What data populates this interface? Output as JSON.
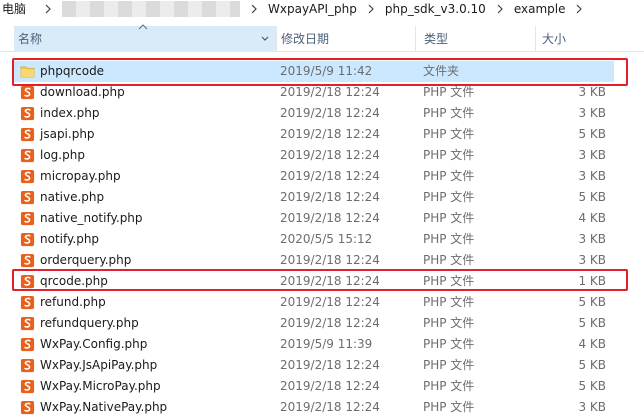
{
  "breadcrumb": {
    "items": [
      "电脑",
      "WxpayAPI_php",
      "php_sdk_v3.0.10",
      "example"
    ]
  },
  "columns": {
    "name": "名称",
    "date": "修改日期",
    "type": "类型",
    "size": "大小"
  },
  "files": [
    {
      "name": "phpqrcode",
      "date": "2019/5/9 11:42",
      "type": "文件夹",
      "size": "",
      "icon": "folder-icon"
    },
    {
      "name": "download.php",
      "date": "2019/2/18 12:24",
      "type": "PHP 文件",
      "size": "3 KB",
      "icon": "php-file-icon"
    },
    {
      "name": "index.php",
      "date": "2019/2/18 12:24",
      "type": "PHP 文件",
      "size": "3 KB",
      "icon": "php-file-icon"
    },
    {
      "name": "jsapi.php",
      "date": "2019/2/18 12:24",
      "type": "PHP 文件",
      "size": "5 KB",
      "icon": "php-file-icon"
    },
    {
      "name": "log.php",
      "date": "2019/2/18 12:24",
      "type": "PHP 文件",
      "size": "3 KB",
      "icon": "php-file-icon"
    },
    {
      "name": "micropay.php",
      "date": "2019/2/18 12:24",
      "type": "PHP 文件",
      "size": "3 KB",
      "icon": "php-file-icon"
    },
    {
      "name": "native.php",
      "date": "2019/2/18 12:24",
      "type": "PHP 文件",
      "size": "5 KB",
      "icon": "php-file-icon"
    },
    {
      "name": "native_notify.php",
      "date": "2019/2/18 12:24",
      "type": "PHP 文件",
      "size": "4 KB",
      "icon": "php-file-icon"
    },
    {
      "name": "notify.php",
      "date": "2020/5/5 15:12",
      "type": "PHP 文件",
      "size": "3 KB",
      "icon": "php-file-icon"
    },
    {
      "name": "orderquery.php",
      "date": "2019/2/18 12:24",
      "type": "PHP 文件",
      "size": "3 KB",
      "icon": "php-file-icon"
    },
    {
      "name": "qrcode.php",
      "date": "2019/2/18 12:24",
      "type": "PHP 文件",
      "size": "1 KB",
      "icon": "php-file-icon"
    },
    {
      "name": "refund.php",
      "date": "2019/2/18 12:24",
      "type": "PHP 文件",
      "size": "5 KB",
      "icon": "php-file-icon"
    },
    {
      "name": "refundquery.php",
      "date": "2019/2/18 12:24",
      "type": "PHP 文件",
      "size": "5 KB",
      "icon": "php-file-icon"
    },
    {
      "name": "WxPay.Config.php",
      "date": "2019/5/9 11:39",
      "type": "PHP 文件",
      "size": "4 KB",
      "icon": "php-file-icon"
    },
    {
      "name": "WxPay.JsApiPay.php",
      "date": "2019/2/18 12:24",
      "type": "PHP 文件",
      "size": "5 KB",
      "icon": "php-file-icon"
    },
    {
      "name": "WxPay.MicroPay.php",
      "date": "2019/2/18 12:24",
      "type": "PHP 文件",
      "size": "5 KB",
      "icon": "php-file-icon"
    },
    {
      "name": "WxPay.NativePay.php",
      "date": "2019/2/18 12:24",
      "type": "PHP 文件",
      "size": "3 KB",
      "icon": "php-file-icon"
    }
  ],
  "colors": {
    "selected_row": "#cce8ff",
    "header_active": "#d9ebf9",
    "highlight_border": "#e0202a",
    "php_icon": "#e8601c",
    "folder_icon": "#f2c94c"
  }
}
